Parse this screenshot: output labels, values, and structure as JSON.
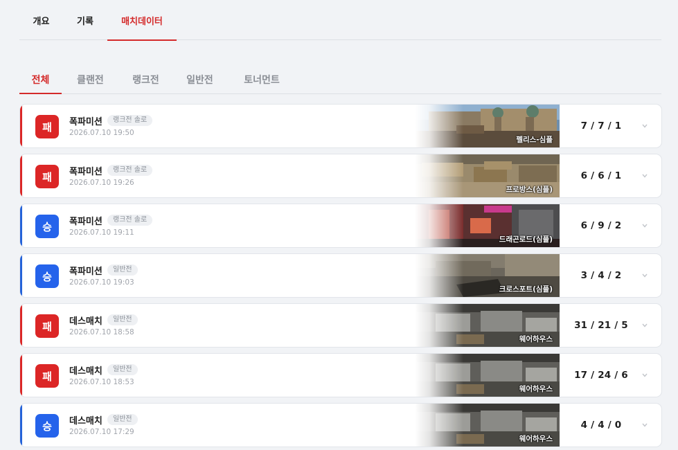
{
  "top_tabs": [
    "개요",
    "기록",
    "매치데이터"
  ],
  "top_tab_active": "매치데이터",
  "sub_tabs": [
    "전체",
    "클랜전",
    "랭크전",
    "일반전",
    "토너먼트"
  ],
  "sub_tab_active": "전체",
  "colors": {
    "accent": "#d42a2a",
    "lose": "#dc2626",
    "win": "#2563eb"
  },
  "matches": [
    {
      "result": "lose",
      "result_label": "패",
      "mode": "폭파미션",
      "tag": "랭크전 솔로",
      "date": "2026.07.10 19:50",
      "map": "펠리스-심플",
      "kda": "7 / 7 / 1"
    },
    {
      "result": "lose",
      "result_label": "패",
      "mode": "폭파미션",
      "tag": "랭크전 솔로",
      "date": "2026.07.10 19:26",
      "map": "프로방스(심플)",
      "kda": "6 / 6 / 1"
    },
    {
      "result": "win",
      "result_label": "승",
      "mode": "폭파미션",
      "tag": "랭크전 솔로",
      "date": "2026.07.10 19:11",
      "map": "드래곤로드(심플)",
      "kda": "6 / 9 / 2"
    },
    {
      "result": "win",
      "result_label": "승",
      "mode": "폭파미션",
      "tag": "일반전",
      "date": "2026.07.10 19:03",
      "map": "크로스포트(심플)",
      "kda": "3 / 4 / 2"
    },
    {
      "result": "lose",
      "result_label": "패",
      "mode": "데스매치",
      "tag": "일반전",
      "date": "2026.07.10 18:58",
      "map": "웨어하우스",
      "kda": "31 / 21 / 5"
    },
    {
      "result": "lose",
      "result_label": "패",
      "mode": "데스매치",
      "tag": "일반전",
      "date": "2026.07.10 18:53",
      "map": "웨어하우스",
      "kda": "17 / 24 / 6"
    },
    {
      "result": "win",
      "result_label": "승",
      "mode": "데스매치",
      "tag": "일반전",
      "date": "2026.07.10 17:29",
      "map": "웨어하우스",
      "kda": "4 / 4 / 0"
    }
  ]
}
